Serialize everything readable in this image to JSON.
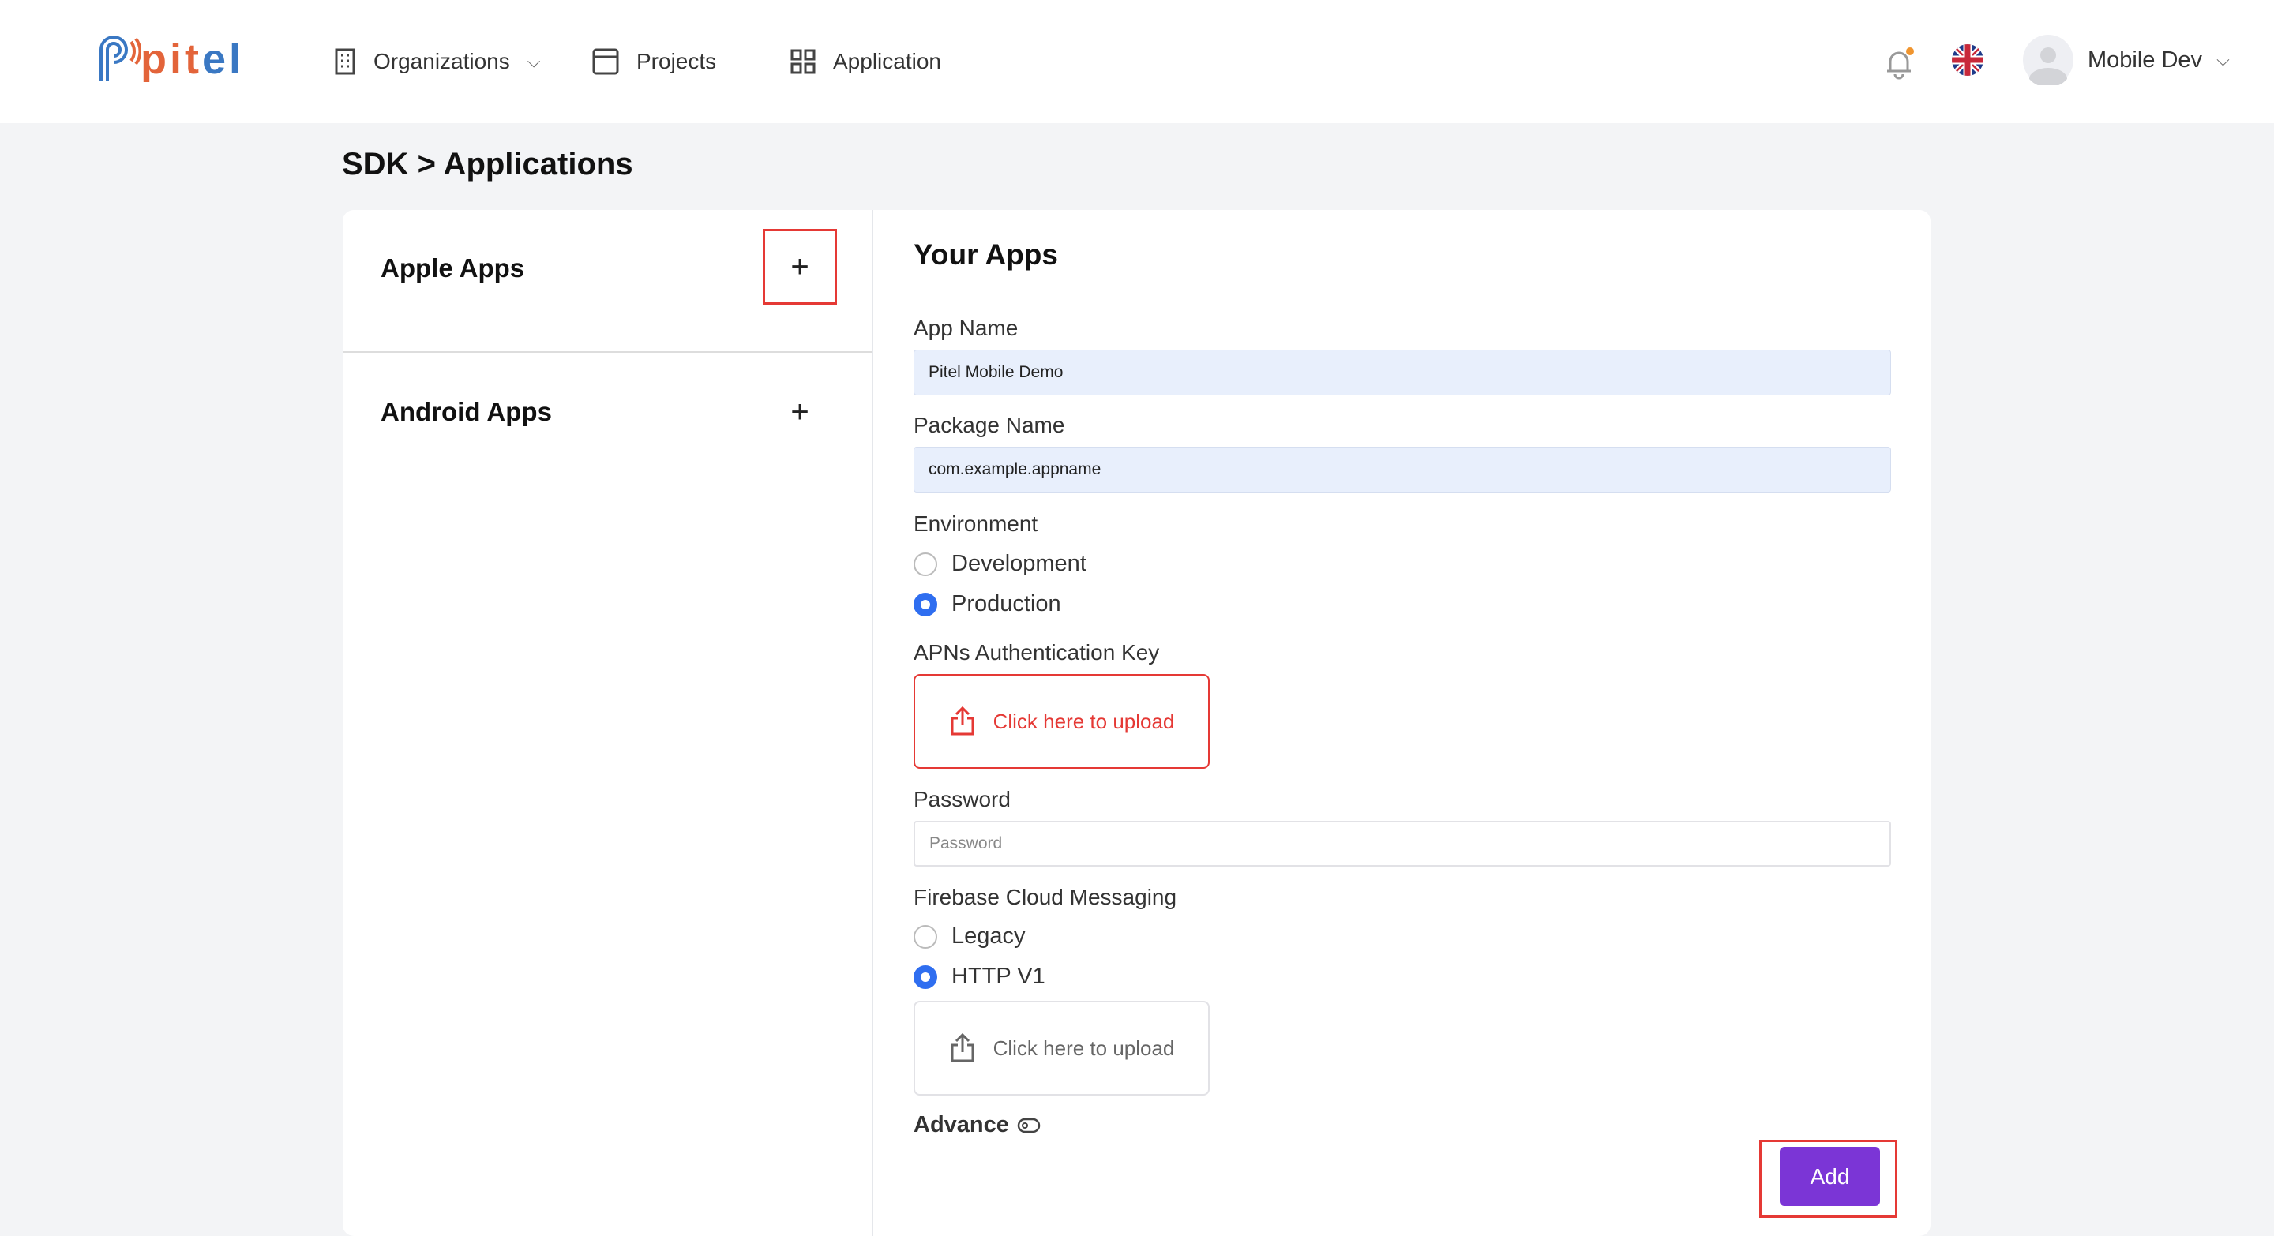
{
  "header": {
    "logo": "pitel",
    "nav": [
      {
        "label": "Organizations",
        "icon": "building-icon"
      },
      {
        "label": "Projects",
        "icon": "window-icon"
      },
      {
        "label": "Application",
        "icon": "grid-icon"
      }
    ],
    "user": "Mobile Dev",
    "notification_dot_color": "#f0952f"
  },
  "page": {
    "title": "SDK > Applications"
  },
  "left": {
    "apple": "Apple Apps",
    "android": "Android Apps",
    "plus": "+"
  },
  "form": {
    "heading": "Your Apps",
    "app_name_label": "App Name",
    "app_name": "Pitel Mobile Demo",
    "package_label": "Package Name",
    "package": "com.example.appname",
    "env_label": "Environment",
    "env_options": [
      "Development",
      "Production"
    ],
    "env_selected": "Production",
    "apns_label": "APNs Authentication Key",
    "upload": "Click here to upload",
    "password_label": "Password",
    "password_placeholder": "Password",
    "fcm_label": "Firebase Cloud Messaging",
    "fcm_options": [
      "Legacy",
      "HTTP V1"
    ],
    "fcm_selected": "HTTP V1",
    "advance": "Advance",
    "advance_enabled": false,
    "add": "Add"
  },
  "colors": {
    "accent": "#7b35d6",
    "radio": "#2f6ef0",
    "highlight": "#e53935"
  }
}
